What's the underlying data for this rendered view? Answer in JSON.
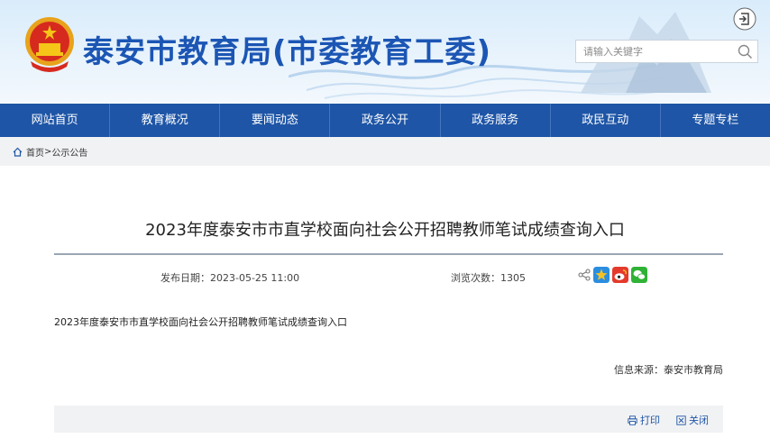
{
  "header": {
    "site_title": "泰安市教育局(市委教育工委)",
    "search_placeholder": "请输入关键字"
  },
  "nav": {
    "items": [
      "网站首页",
      "教育概况",
      "要闻动态",
      "政务公开",
      "政务服务",
      "政民互动",
      "专题专栏"
    ]
  },
  "breadcrumb": {
    "home": "首页",
    "separator": ">",
    "current": "公示公告"
  },
  "article": {
    "title": "2023年度泰安市市直学校面向社会公开招聘教师笔试成绩查询入口",
    "date_label": "发布日期：",
    "date": "2023-05-25 11:00",
    "views_label": "浏览次数：",
    "views": "1305",
    "body": "2023年度泰安市市直学校面向社会公开招聘教师笔试成绩查询入口",
    "source_label": "信息来源：",
    "source": "泰安市教育局"
  },
  "actions": {
    "print": "打印",
    "close": "关闭"
  },
  "colors": {
    "nav_bg": "#1e55a6",
    "title_blue": "#1c56b4",
    "crumb_bg": "#f1f2f4"
  },
  "icons": [
    "national-emblem-icon",
    "login-icon",
    "search-icon",
    "home-icon",
    "share-icon",
    "qzone-icon",
    "weibo-icon",
    "wechat-icon",
    "print-icon",
    "close-icon"
  ]
}
